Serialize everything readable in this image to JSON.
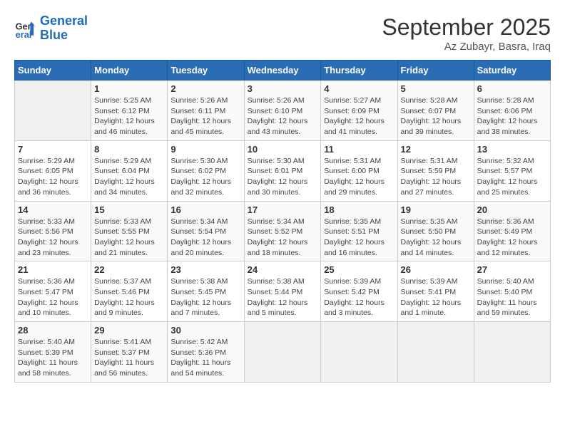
{
  "header": {
    "logo_line1": "General",
    "logo_line2": "Blue",
    "month": "September 2025",
    "location": "Az Zubayr, Basra, Iraq"
  },
  "weekdays": [
    "Sunday",
    "Monday",
    "Tuesday",
    "Wednesday",
    "Thursday",
    "Friday",
    "Saturday"
  ],
  "weeks": [
    [
      {
        "day": "",
        "info": ""
      },
      {
        "day": "1",
        "info": "Sunrise: 5:25 AM\nSunset: 6:12 PM\nDaylight: 12 hours\nand 46 minutes."
      },
      {
        "day": "2",
        "info": "Sunrise: 5:26 AM\nSunset: 6:11 PM\nDaylight: 12 hours\nand 45 minutes."
      },
      {
        "day": "3",
        "info": "Sunrise: 5:26 AM\nSunset: 6:10 PM\nDaylight: 12 hours\nand 43 minutes."
      },
      {
        "day": "4",
        "info": "Sunrise: 5:27 AM\nSunset: 6:09 PM\nDaylight: 12 hours\nand 41 minutes."
      },
      {
        "day": "5",
        "info": "Sunrise: 5:28 AM\nSunset: 6:07 PM\nDaylight: 12 hours\nand 39 minutes."
      },
      {
        "day": "6",
        "info": "Sunrise: 5:28 AM\nSunset: 6:06 PM\nDaylight: 12 hours\nand 38 minutes."
      }
    ],
    [
      {
        "day": "7",
        "info": "Sunrise: 5:29 AM\nSunset: 6:05 PM\nDaylight: 12 hours\nand 36 minutes."
      },
      {
        "day": "8",
        "info": "Sunrise: 5:29 AM\nSunset: 6:04 PM\nDaylight: 12 hours\nand 34 minutes."
      },
      {
        "day": "9",
        "info": "Sunrise: 5:30 AM\nSunset: 6:02 PM\nDaylight: 12 hours\nand 32 minutes."
      },
      {
        "day": "10",
        "info": "Sunrise: 5:30 AM\nSunset: 6:01 PM\nDaylight: 12 hours\nand 30 minutes."
      },
      {
        "day": "11",
        "info": "Sunrise: 5:31 AM\nSunset: 6:00 PM\nDaylight: 12 hours\nand 29 minutes."
      },
      {
        "day": "12",
        "info": "Sunrise: 5:31 AM\nSunset: 5:59 PM\nDaylight: 12 hours\nand 27 minutes."
      },
      {
        "day": "13",
        "info": "Sunrise: 5:32 AM\nSunset: 5:57 PM\nDaylight: 12 hours\nand 25 minutes."
      }
    ],
    [
      {
        "day": "14",
        "info": "Sunrise: 5:33 AM\nSunset: 5:56 PM\nDaylight: 12 hours\nand 23 minutes."
      },
      {
        "day": "15",
        "info": "Sunrise: 5:33 AM\nSunset: 5:55 PM\nDaylight: 12 hours\nand 21 minutes."
      },
      {
        "day": "16",
        "info": "Sunrise: 5:34 AM\nSunset: 5:54 PM\nDaylight: 12 hours\nand 20 minutes."
      },
      {
        "day": "17",
        "info": "Sunrise: 5:34 AM\nSunset: 5:52 PM\nDaylight: 12 hours\nand 18 minutes."
      },
      {
        "day": "18",
        "info": "Sunrise: 5:35 AM\nSunset: 5:51 PM\nDaylight: 12 hours\nand 16 minutes."
      },
      {
        "day": "19",
        "info": "Sunrise: 5:35 AM\nSunset: 5:50 PM\nDaylight: 12 hours\nand 14 minutes."
      },
      {
        "day": "20",
        "info": "Sunrise: 5:36 AM\nSunset: 5:49 PM\nDaylight: 12 hours\nand 12 minutes."
      }
    ],
    [
      {
        "day": "21",
        "info": "Sunrise: 5:36 AM\nSunset: 5:47 PM\nDaylight: 12 hours\nand 10 minutes."
      },
      {
        "day": "22",
        "info": "Sunrise: 5:37 AM\nSunset: 5:46 PM\nDaylight: 12 hours\nand 9 minutes."
      },
      {
        "day": "23",
        "info": "Sunrise: 5:38 AM\nSunset: 5:45 PM\nDaylight: 12 hours\nand 7 minutes."
      },
      {
        "day": "24",
        "info": "Sunrise: 5:38 AM\nSunset: 5:44 PM\nDaylight: 12 hours\nand 5 minutes."
      },
      {
        "day": "25",
        "info": "Sunrise: 5:39 AM\nSunset: 5:42 PM\nDaylight: 12 hours\nand 3 minutes."
      },
      {
        "day": "26",
        "info": "Sunrise: 5:39 AM\nSunset: 5:41 PM\nDaylight: 12 hours\nand 1 minute."
      },
      {
        "day": "27",
        "info": "Sunrise: 5:40 AM\nSunset: 5:40 PM\nDaylight: 11 hours\nand 59 minutes."
      }
    ],
    [
      {
        "day": "28",
        "info": "Sunrise: 5:40 AM\nSunset: 5:39 PM\nDaylight: 11 hours\nand 58 minutes."
      },
      {
        "day": "29",
        "info": "Sunrise: 5:41 AM\nSunset: 5:37 PM\nDaylight: 11 hours\nand 56 minutes."
      },
      {
        "day": "30",
        "info": "Sunrise: 5:42 AM\nSunset: 5:36 PM\nDaylight: 11 hours\nand 54 minutes."
      },
      {
        "day": "",
        "info": ""
      },
      {
        "day": "",
        "info": ""
      },
      {
        "day": "",
        "info": ""
      },
      {
        "day": "",
        "info": ""
      }
    ]
  ]
}
